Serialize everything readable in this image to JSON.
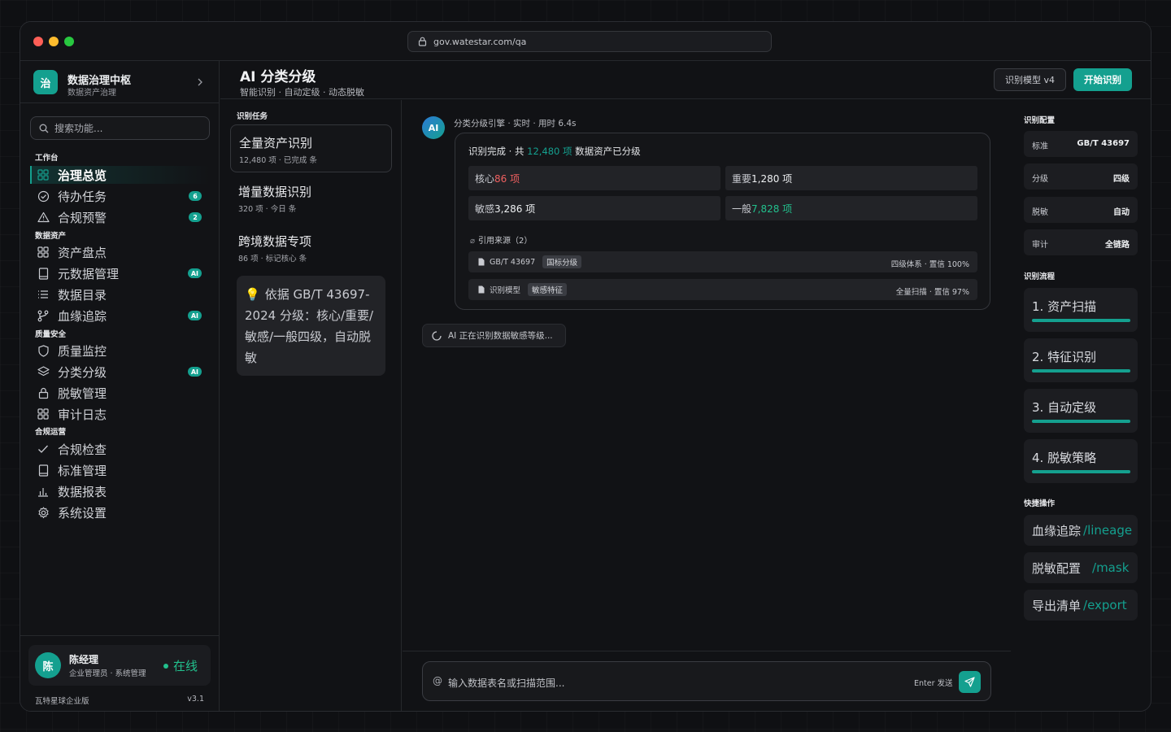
{
  "browser": {
    "url": "gov.watestar.com/qa"
  },
  "brand": {
    "logo": "治",
    "name": "数据治理中枢",
    "sub": "数据资产治理"
  },
  "sidebar": {
    "search_placeholder": "搜索功能...",
    "sections": [
      {
        "title": "工作台",
        "items": [
          {
            "label": "治理总览",
            "icon": "grid-icon",
            "active": true,
            "badge": ""
          },
          {
            "label": "待办任务",
            "icon": "check-circle-icon",
            "badge": "6"
          },
          {
            "label": "合规预警",
            "icon": "warning-icon",
            "badge": "2"
          }
        ]
      },
      {
        "title": "数据资产",
        "items": [
          {
            "label": "资产盘点",
            "icon": "grid-icon",
            "badge": ""
          },
          {
            "label": "元数据管理",
            "icon": "book-icon",
            "badge": "AI"
          },
          {
            "label": "数据目录",
            "icon": "list-icon",
            "badge": ""
          },
          {
            "label": "血缘追踪",
            "icon": "branch-icon",
            "badge": "AI"
          }
        ]
      },
      {
        "title": "质量安全",
        "items": [
          {
            "label": "质量监控",
            "icon": "shield-icon",
            "badge": ""
          },
          {
            "label": "分类分级",
            "icon": "layers-icon",
            "badge": "AI"
          },
          {
            "label": "脱敏管理",
            "icon": "lock-icon",
            "badge": ""
          },
          {
            "label": "审计日志",
            "icon": "grid-icon",
            "badge": ""
          }
        ]
      },
      {
        "title": "合规运营",
        "items": [
          {
            "label": "合规检查",
            "icon": "check-icon",
            "badge": ""
          },
          {
            "label": "标准管理",
            "icon": "book-icon",
            "badge": ""
          },
          {
            "label": "数据报表",
            "icon": "bar-chart-icon",
            "badge": ""
          },
          {
            "label": "系统设置",
            "icon": "gear-icon",
            "badge": ""
          }
        ]
      }
    ],
    "user": {
      "avatar": "陈",
      "name": "陈经理",
      "role": "企业管理员 · 系统管理",
      "status": "在线"
    },
    "footer": {
      "left": "瓦特星球企业版",
      "right": "v3.1"
    }
  },
  "header": {
    "title": "AI 分类分级",
    "subtitle": "智能识别 · 自动定级 · 动态脱敏",
    "model_button": "识别模型 v4",
    "start_button": "开始识别"
  },
  "tasks": {
    "title": "识别任务",
    "items": [
      {
        "name": "全量资产识别",
        "meta": "12,480 项 · 已完成 条",
        "active": true
      },
      {
        "name": "增量数据识别",
        "meta": "320 项 · 今日 条"
      },
      {
        "name": "跨境数据专项",
        "meta": "86 项 · 标记核心 条"
      }
    ],
    "tip": "依据 GB/T 43697-2024 分级：核心/重要/敏感/一般四级，自动脱敏"
  },
  "chat": {
    "ai_label": "AI",
    "meta": "分类分级引擎 · 实时 · 用时 6.4s",
    "result": {
      "prefix": "识别完成 · 共 ",
      "count": "12,480 项",
      "suffix": " 数据资产已分级",
      "stats": [
        {
          "label": "核心 ",
          "value": "86 项",
          "tone": "red"
        },
        {
          "label": "重要 ",
          "value": "1,280 项",
          "tone": "white"
        },
        {
          "label": "敏感 ",
          "value": "3,286 项",
          "tone": "white"
        },
        {
          "label": "一般 ",
          "value": "7,828 项",
          "tone": "teal"
        }
      ],
      "refs_title": "引用来源（2）",
      "refs": [
        {
          "name": "GB/T 43697",
          "tag": "国标分级",
          "right": "四级体系 · 置信 100%"
        },
        {
          "name": "识别模型",
          "tag": "敏感特征",
          "right": "全量扫描 · 置信 97%"
        }
      ]
    },
    "status": "AI 正在识别数据敏感等级...",
    "input_prefix": "@",
    "input_placeholder": "输入数据表名或扫描范围...",
    "enter_hint": "Enter 发送"
  },
  "right_panel": {
    "config_title": "识别配置",
    "config": [
      {
        "key": "标准",
        "value": "GB/T 43697"
      },
      {
        "key": "分级",
        "value": "四级"
      },
      {
        "key": "脱敏",
        "value": "自动"
      },
      {
        "key": "审计",
        "value": "全链路"
      }
    ],
    "flow_title": "识别流程",
    "steps": [
      {
        "name": "1. 资产扫描",
        "progress": 1.0
      },
      {
        "name": "2. 特征识别",
        "progress": 1.0
      },
      {
        "name": "3. 自动定级",
        "progress": 1.0
      },
      {
        "name": "4. 脱敏策略",
        "progress": 1.0
      }
    ],
    "actions_title": "快捷操作",
    "actions": [
      {
        "label": "血缘追踪",
        "cmd": "/lineage"
      },
      {
        "label": "脱敏配置",
        "cmd": "/mask"
      },
      {
        "label": "导出清单",
        "cmd": "/export"
      }
    ]
  },
  "colors": {
    "accent": "#14a08f",
    "danger": "#f06060",
    "success": "#22c08d"
  }
}
